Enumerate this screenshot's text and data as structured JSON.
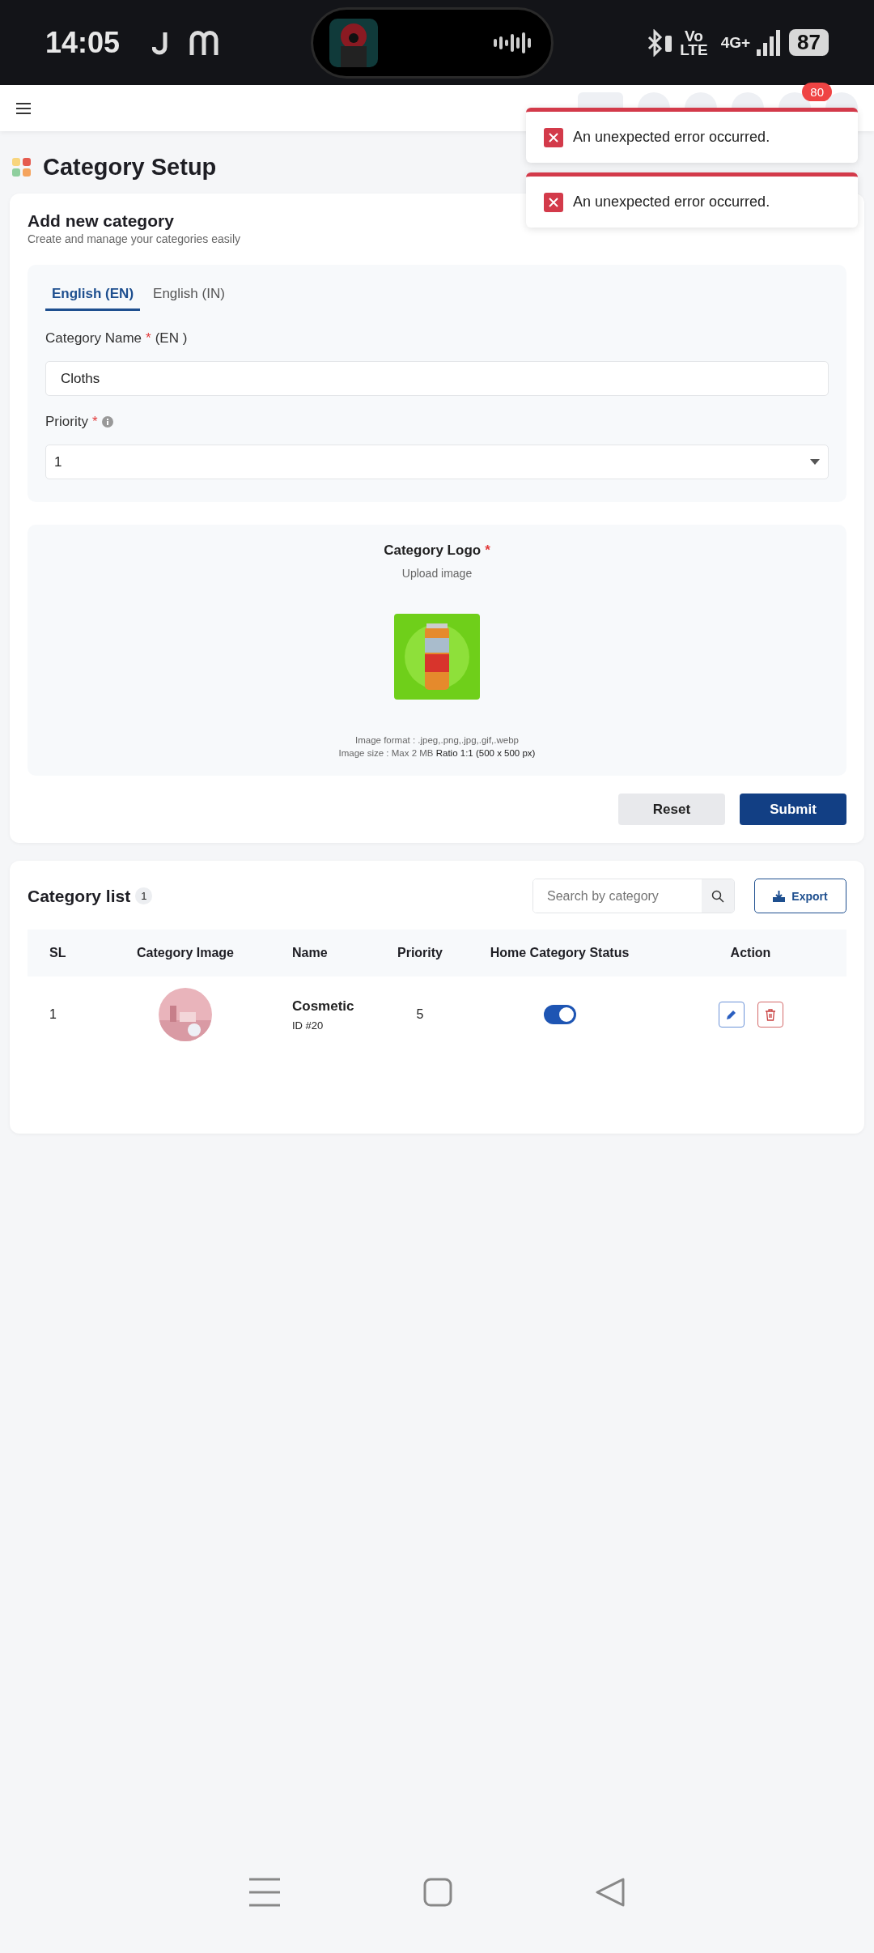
{
  "status_bar": {
    "time": "14:05",
    "network": "Vo\nLTE",
    "cellular": "4G+",
    "battery": "87"
  },
  "top_nav": {
    "notification_count": "80"
  },
  "toasts": [
    {
      "message": "An unexpected error occurred."
    },
    {
      "message": "An unexpected error occurred."
    }
  ],
  "page_title": "Category Setup",
  "form": {
    "title": "Add new category",
    "subtitle": "Create and manage your categories easily",
    "tabs": [
      {
        "label": "English (EN)",
        "selected": true
      },
      {
        "label": "English (IN)",
        "selected": false
      }
    ],
    "required_mark": "*",
    "name_label": "Category Name",
    "name_suffix": "(EN )",
    "name_value": "Cloths",
    "priority_label": "Priority",
    "priority_value": "1",
    "logo_title": "Category Logo",
    "logo_hint": "Upload image",
    "format_note": "Image format : .jpeg,.png,.jpg,.gif,.webp",
    "size_note": "Image size : Max 2 MB **Ratio 1:1 (500 x 500 px)**",
    "buttons": [
      {
        "label": "Reset",
        "kind": "secondary"
      },
      {
        "label": "Submit",
        "kind": "primary"
      }
    ]
  },
  "list": {
    "title": "Category list",
    "count": "1",
    "search_placeholder": "Search by category",
    "export_label": "Export",
    "columns": [
      "SL",
      "Category Image",
      "Name",
      "Priority",
      "Home Category Status",
      "Action"
    ],
    "rows": [
      {
        "sl": "1",
        "name": "Cosmetic",
        "id": "ID #20",
        "priority": "5",
        "home_status": true
      }
    ]
  }
}
